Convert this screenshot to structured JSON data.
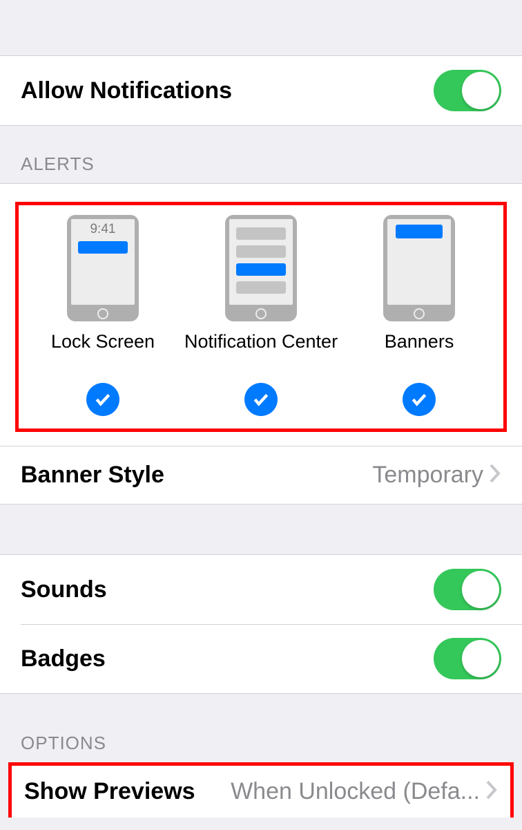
{
  "allow": {
    "label": "Allow Notifications",
    "enabled": true
  },
  "sections": {
    "alerts_header": "ALERTS",
    "options_header": "OPTIONS"
  },
  "alerts": {
    "lock_time": "9:41",
    "options": [
      {
        "label": "Lock Screen",
        "checked": true
      },
      {
        "label": "Notification Center",
        "checked": true
      },
      {
        "label": "Banners",
        "checked": true
      }
    ]
  },
  "banner_style": {
    "label": "Banner Style",
    "value": "Temporary"
  },
  "sounds": {
    "label": "Sounds",
    "enabled": true
  },
  "badges": {
    "label": "Badges",
    "enabled": true
  },
  "show_previews": {
    "label": "Show Previews",
    "value": "When Unlocked (Defa..."
  }
}
